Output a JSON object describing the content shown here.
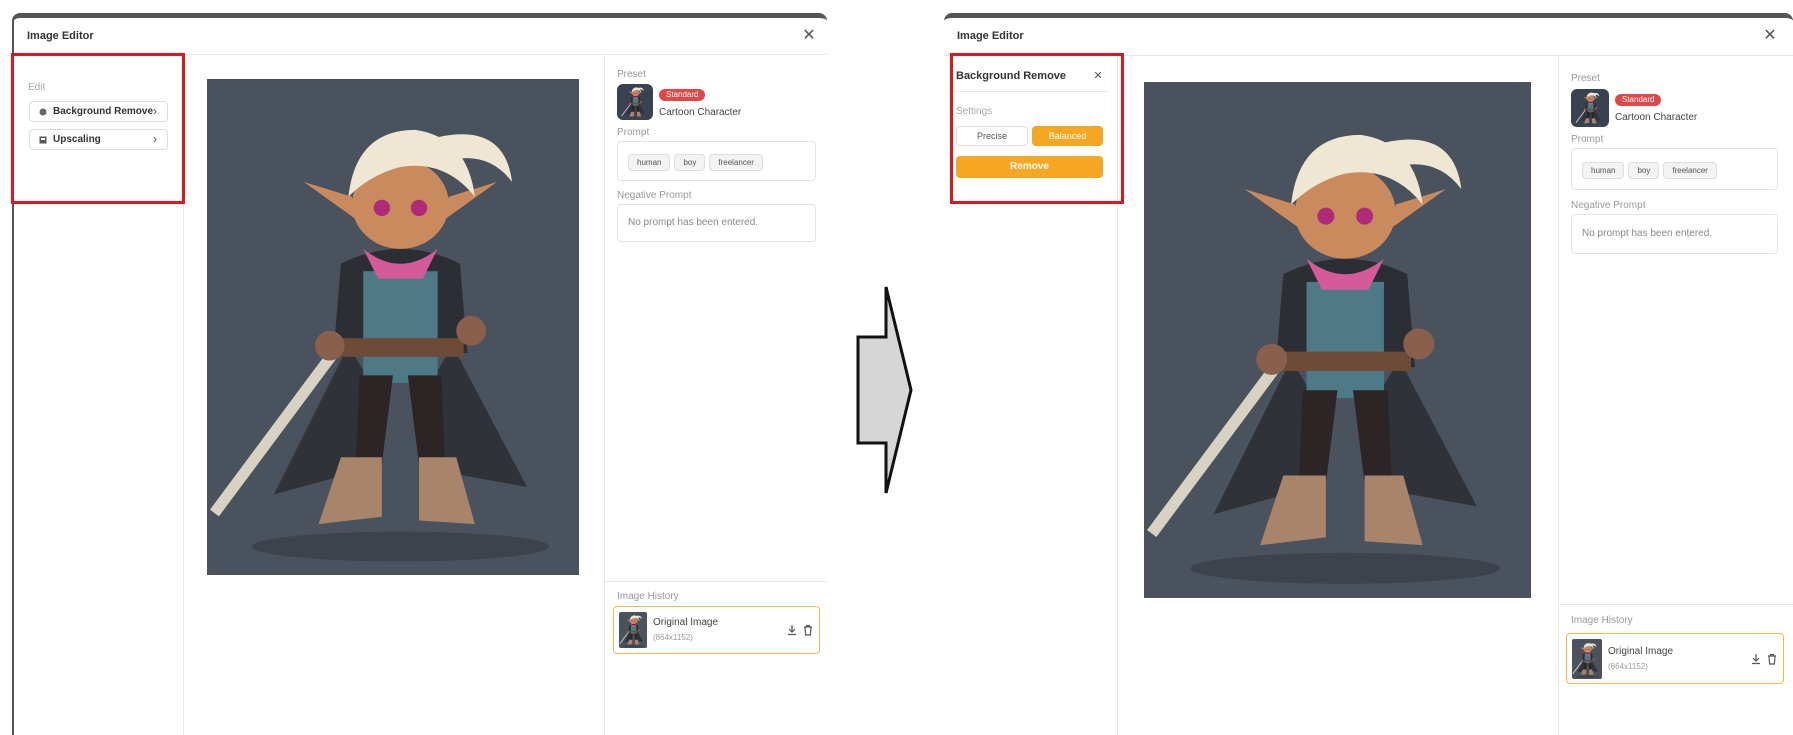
{
  "left_panel": {
    "title": "Image Editor",
    "edit_label": "Edit",
    "menu": [
      {
        "label": "Background Remove",
        "icon": "background-remove-icon"
      },
      {
        "label": "Upscaling",
        "icon": "upscale-icon"
      }
    ]
  },
  "right_panel": {
    "title": "Image Editor",
    "bg_remove": {
      "title": "Background Remove",
      "settings_label": "Settings",
      "options": [
        "Precise",
        "Balanced"
      ],
      "selected": "Balanced",
      "action_label": "Remove"
    }
  },
  "sidebar": {
    "preset_label": "Preset",
    "preset_badge": "Standard",
    "preset_name": "Cartoon Character",
    "prompt_label": "Prompt",
    "prompt_tags": [
      "human",
      "boy",
      "freelancer"
    ],
    "negative_label": "Negative Prompt",
    "negative_placeholder": "No prompt has been entered.",
    "history_label": "Image History",
    "history_item_title": "Original Image",
    "history_item_size": "(864x1152)"
  },
  "colors": {
    "accent": "#f5a623",
    "badge": "#e04848",
    "highlight": "#d9181f",
    "image_bg": "#4a525d"
  }
}
